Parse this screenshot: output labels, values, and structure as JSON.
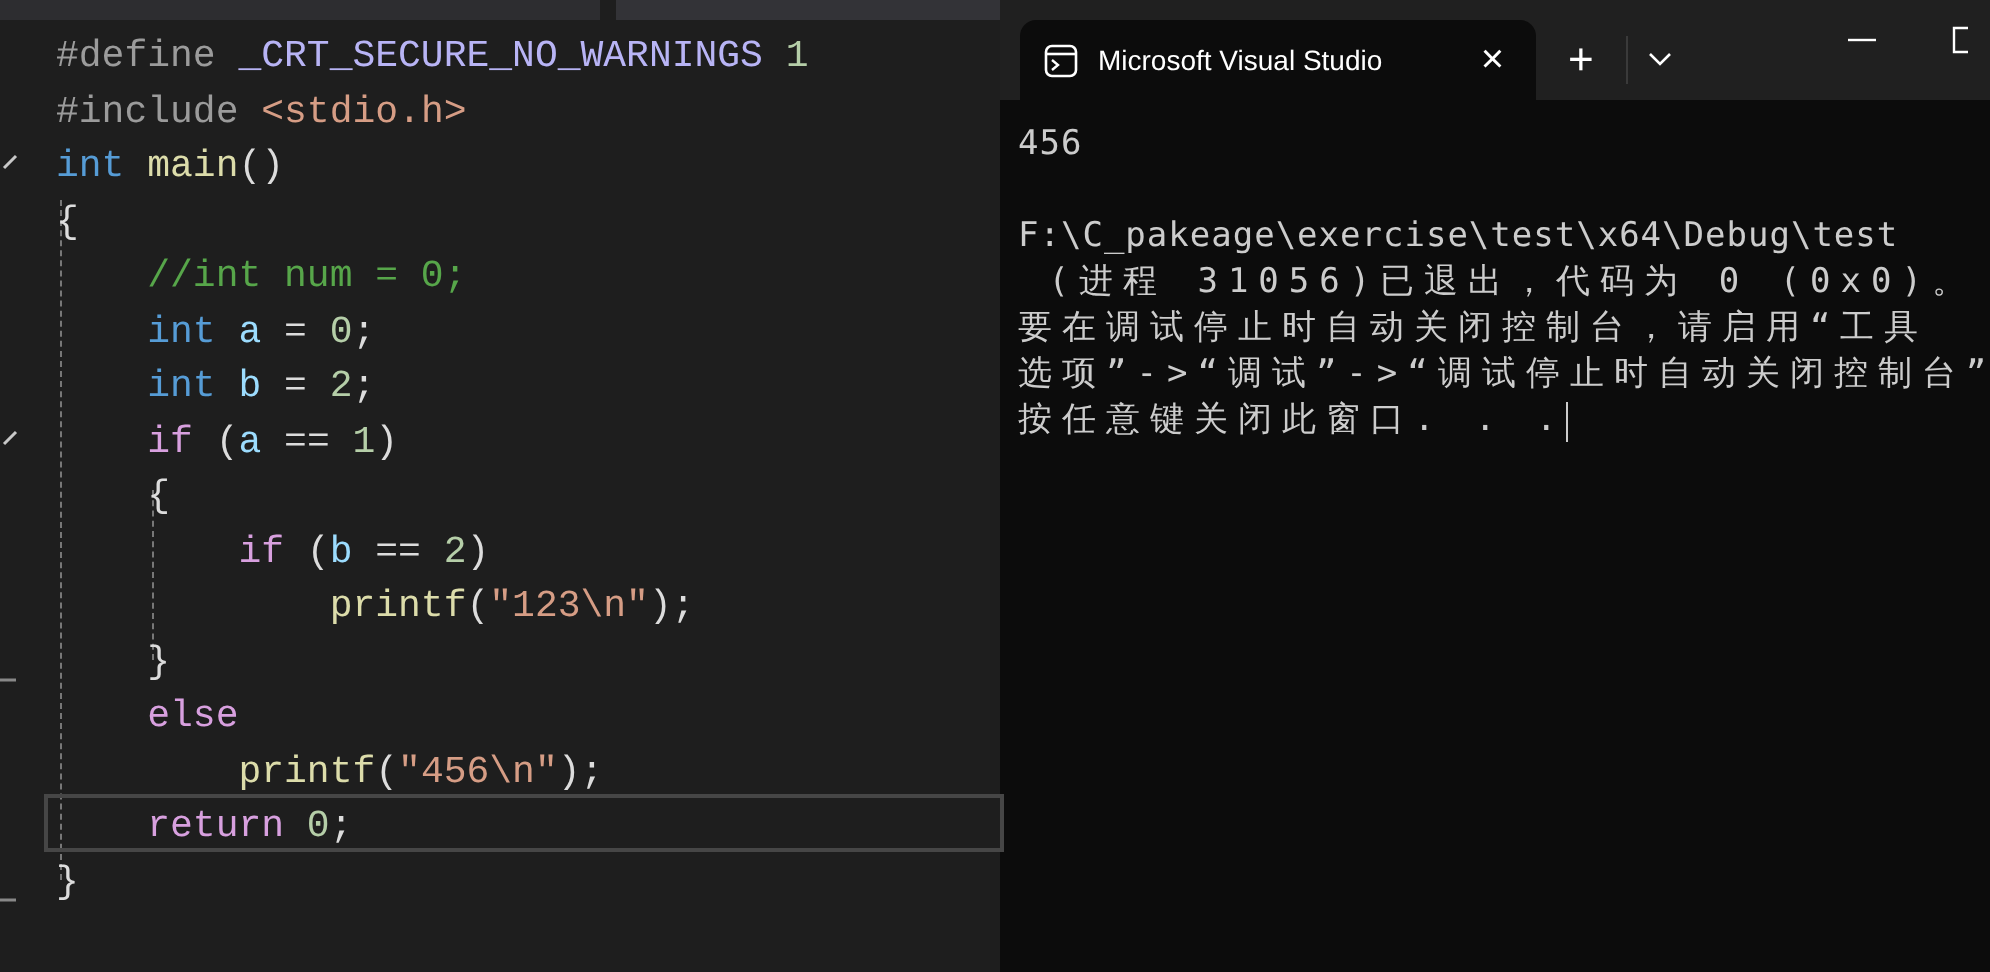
{
  "editor": {
    "lines": [
      {
        "collapsible": false,
        "fold_end": false,
        "current": false,
        "tokens": [
          {
            "text": "#define ",
            "kind": "preproc"
          },
          {
            "text": "_CRT_SECURE_NO_WARNINGS",
            "kind": "macro"
          },
          {
            "text": " 1",
            "kind": "number"
          }
        ]
      },
      {
        "collapsible": false,
        "fold_end": false,
        "current": false,
        "tokens": [
          {
            "text": "#include ",
            "kind": "preproc"
          },
          {
            "text": "<stdio.h>",
            "kind": "string"
          }
        ]
      },
      {
        "collapsible": true,
        "fold_end": false,
        "current": false,
        "tokens": [
          {
            "text": "int",
            "kind": "keyword"
          },
          {
            "text": " main",
            "kind": "function"
          },
          {
            "text": "()",
            "kind": "plain"
          }
        ]
      },
      {
        "collapsible": false,
        "fold_end": false,
        "current": false,
        "tokens": [
          {
            "text": "{",
            "kind": "plain"
          }
        ]
      },
      {
        "collapsible": false,
        "fold_end": false,
        "current": false,
        "tokens": [
          {
            "text": "    //int num = 0;",
            "kind": "comment"
          }
        ]
      },
      {
        "collapsible": false,
        "fold_end": false,
        "current": false,
        "tokens": [
          {
            "text": "    int",
            "kind": "keyword"
          },
          {
            "text": " a",
            "kind": "variable"
          },
          {
            "text": " = ",
            "kind": "plain"
          },
          {
            "text": "0",
            "kind": "number"
          },
          {
            "text": ";",
            "kind": "plain"
          }
        ]
      },
      {
        "collapsible": false,
        "fold_end": false,
        "current": false,
        "tokens": [
          {
            "text": "    int",
            "kind": "keyword"
          },
          {
            "text": " b",
            "kind": "variable"
          },
          {
            "text": " = ",
            "kind": "plain"
          },
          {
            "text": "2",
            "kind": "number"
          },
          {
            "text": ";",
            "kind": "plain"
          }
        ]
      },
      {
        "collapsible": true,
        "fold_end": false,
        "current": false,
        "tokens": [
          {
            "text": "    if",
            "kind": "control"
          },
          {
            "text": " (",
            "kind": "plain"
          },
          {
            "text": "a",
            "kind": "variable"
          },
          {
            "text": " == ",
            "kind": "plain"
          },
          {
            "text": "1",
            "kind": "number"
          },
          {
            "text": ")",
            "kind": "plain"
          }
        ]
      },
      {
        "collapsible": false,
        "fold_end": false,
        "current": false,
        "tokens": [
          {
            "text": "    {",
            "kind": "plain"
          }
        ]
      },
      {
        "collapsible": false,
        "fold_end": false,
        "current": false,
        "tokens": [
          {
            "text": "        if",
            "kind": "control"
          },
          {
            "text": " (",
            "kind": "plain"
          },
          {
            "text": "b",
            "kind": "variable"
          },
          {
            "text": " == ",
            "kind": "plain"
          },
          {
            "text": "2",
            "kind": "number"
          },
          {
            "text": ")",
            "kind": "plain"
          }
        ]
      },
      {
        "collapsible": false,
        "fold_end": false,
        "current": false,
        "tokens": [
          {
            "text": "            printf",
            "kind": "function"
          },
          {
            "text": "(",
            "kind": "plain"
          },
          {
            "text": "\"123\\n\"",
            "kind": "string"
          },
          {
            "text": ");",
            "kind": "plain"
          }
        ]
      },
      {
        "collapsible": false,
        "fold_end": true,
        "current": false,
        "tokens": [
          {
            "text": "    }",
            "kind": "plain"
          }
        ]
      },
      {
        "collapsible": false,
        "fold_end": false,
        "current": false,
        "tokens": [
          {
            "text": "    else",
            "kind": "control"
          }
        ]
      },
      {
        "collapsible": false,
        "fold_end": false,
        "current": false,
        "tokens": [
          {
            "text": "        printf",
            "kind": "function"
          },
          {
            "text": "(",
            "kind": "plain"
          },
          {
            "text": "\"456\\n\"",
            "kind": "string"
          },
          {
            "text": ");",
            "kind": "plain"
          }
        ]
      },
      {
        "collapsible": false,
        "fold_end": false,
        "current": true,
        "tokens": [
          {
            "text": "    return",
            "kind": "control"
          },
          {
            "text": " 0",
            "kind": "number"
          },
          {
            "text": ";",
            "kind": "plain"
          }
        ]
      },
      {
        "collapsible": false,
        "fold_end": true,
        "current": false,
        "tokens": [
          {
            "text": "}",
            "kind": "plain"
          }
        ]
      }
    ]
  },
  "terminal": {
    "tab": {
      "title": "Microsoft Visual Studio",
      "close": "×"
    },
    "new_tab": "+",
    "blocks": [
      {
        "lines": [
          "456"
        ]
      },
      {
        "lines": [
          "F:\\C_pakeage\\exercise\\test\\x64\\Debug\\test",
          " (进程 31056)已退出，代码为 0 (0x0)。",
          "要在调试停止时自动关闭控制台，请启用“工具",
          "选项”->“调试”->“调试停止时自动关闭控制台”",
          "按任意键关闭此窗口. . ."
        ]
      }
    ]
  }
}
